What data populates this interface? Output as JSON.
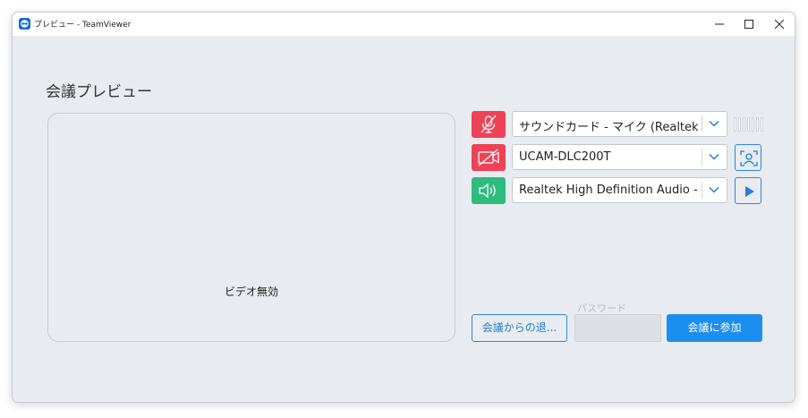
{
  "window": {
    "title": "プレビュー - TeamViewer"
  },
  "main": {
    "heading": "会議プレビュー",
    "video_status": "ビデオ無効"
  },
  "devices": {
    "microphone": {
      "selected": "サウンドカード - マイク (Realtek Hi...",
      "muted": true
    },
    "camera": {
      "selected": "UCAM-DLC200T",
      "disabled": true
    },
    "speaker": {
      "selected": "Realtek High Definition Audio - ...",
      "enabled": true
    }
  },
  "password": {
    "label": "パスワード",
    "value": ""
  },
  "buttons": {
    "leave_label": "会議からの退...",
    "join_label": "会議に参加"
  },
  "colors": {
    "muted_red": "#ef4256",
    "active_green": "#2dbb7e",
    "accent_blue": "#1c8ef0",
    "window_bg": "#e8ebef"
  },
  "icons": {
    "app": "teamviewer-logo-icon",
    "microphone": "microphone-off-icon",
    "camera": "camera-off-icon",
    "speaker": "speaker-icon",
    "camera_settings": "face-focus-icon",
    "play": "play-icon"
  }
}
